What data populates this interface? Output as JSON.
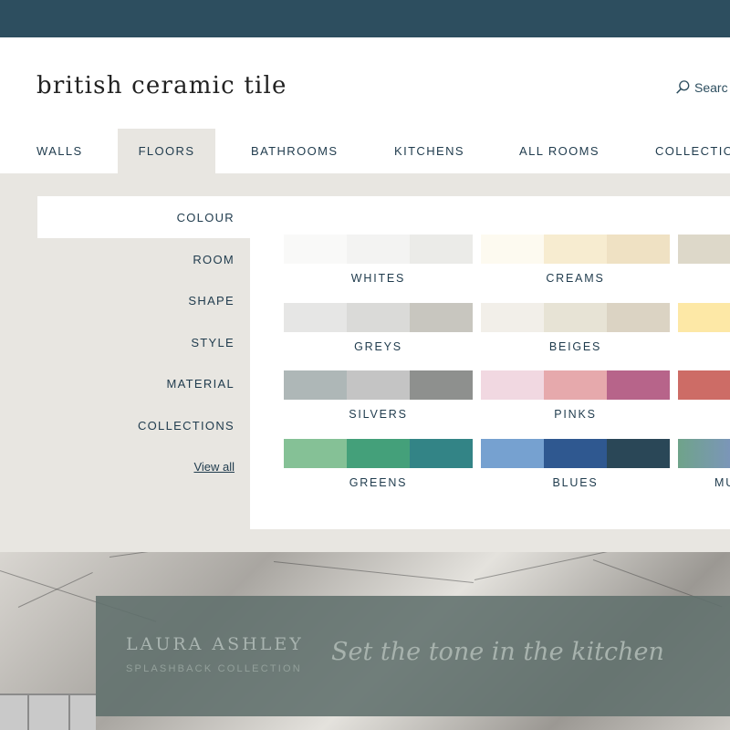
{
  "header": {
    "logo": "british ceramic tile",
    "search_label": "Searc"
  },
  "nav": {
    "items": [
      {
        "label": "WALLS"
      },
      {
        "label": "FLOORS"
      },
      {
        "label": "BATHROOMS"
      },
      {
        "label": "KITCHENS"
      },
      {
        "label": "ALL ROOMS"
      },
      {
        "label": "COLLECTIO"
      }
    ],
    "active": "FLOORS"
  },
  "mega_menu": {
    "side_items": [
      {
        "label": "COLOUR"
      },
      {
        "label": "ROOM"
      },
      {
        "label": "SHAPE"
      },
      {
        "label": "STYLE"
      },
      {
        "label": "MATERIAL"
      },
      {
        "label": "COLLECTIONS"
      }
    ],
    "active_side_item": "COLOUR",
    "view_all": "View all",
    "colour_groups": [
      {
        "label": "WHITES",
        "colors": [
          "#f9f9f8",
          "#f3f3f2",
          "#ebebe8"
        ]
      },
      {
        "label": "CREAMS",
        "colors": [
          "#fdfaf0",
          "#f7ecd0",
          "#efe1c3"
        ]
      },
      {
        "label": "",
        "colors": [
          "#ddd8c9"
        ]
      },
      {
        "label": "GREYS",
        "colors": [
          "#e6e6e5",
          "#dadad8",
          "#c8c6bf"
        ]
      },
      {
        "label": "BEIGES",
        "colors": [
          "#f2efe9",
          "#e7e3d5",
          "#dbd3c3"
        ]
      },
      {
        "label": "",
        "colors": [
          "#fde8a6"
        ]
      },
      {
        "label": "SILVERS",
        "colors": [
          "#aeb7b7",
          "#c4c4c4",
          "#8e908e"
        ]
      },
      {
        "label": "PINKS",
        "colors": [
          "#f1d8e1",
          "#e6a9ac",
          "#b7648a"
        ]
      },
      {
        "label": "",
        "colors": [
          "#cd6c66"
        ]
      },
      {
        "label": "GREENS",
        "colors": [
          "#85c196",
          "#44a07a",
          "#338486"
        ]
      },
      {
        "label": "BLUES",
        "colors": [
          "#76a1d0",
          "#2f5890",
          "#2a4757"
        ]
      },
      {
        "label": "MU",
        "colors": [
          "#6fa38a"
        ]
      }
    ]
  },
  "hero": {
    "brand": "LAURA ASHLEY",
    "subtitle": "SPLASHBACK COLLECTION",
    "tagline": "Set the tone in the kitchen"
  },
  "colors": {
    "topbar": "#2d4e5f",
    "menu_background": "#e8e6e1",
    "text": "#1f3b4d"
  }
}
